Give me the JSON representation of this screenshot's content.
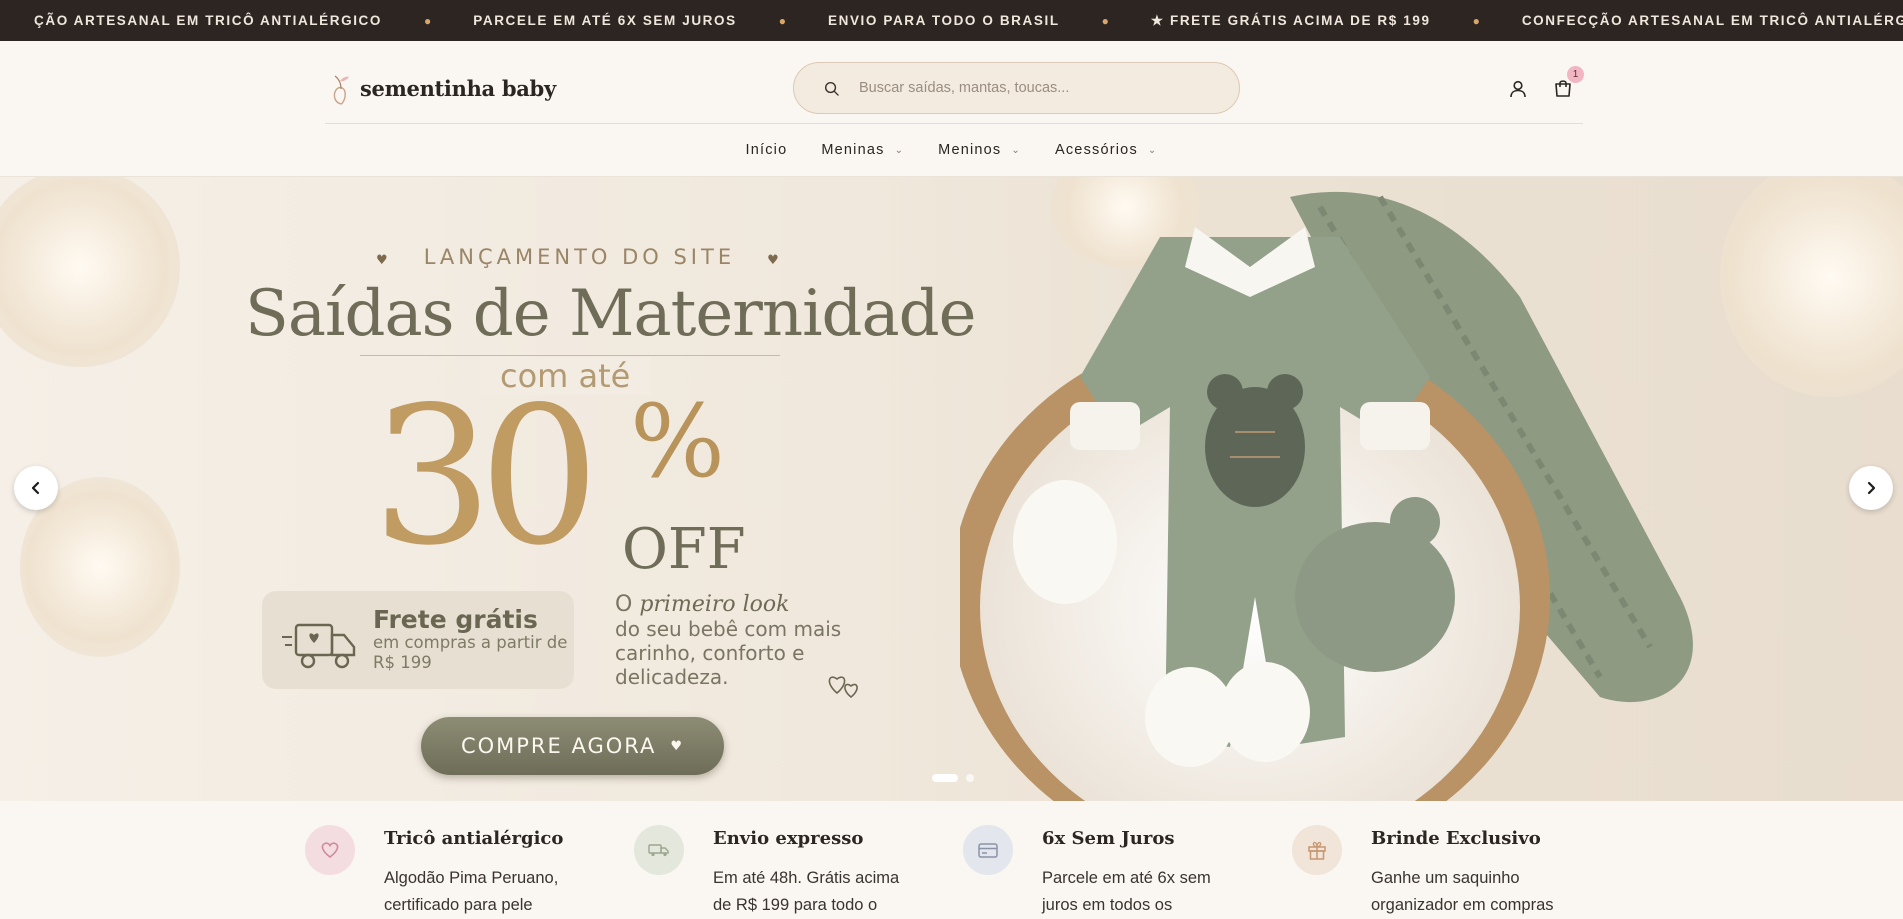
{
  "announcement": {
    "items": [
      "ÇÃO ARTESANAL EM TRICÔ ANTIALÉRGICO",
      "PARCELE EM ATÉ 6X SEM JUROS",
      "ENVIO PARA TODO O BRASIL",
      "★ FRETE GRÁTIS ACIMA DE R$ 199",
      "CONFECÇÃO ARTESANAL EM TRICÔ ANTIALÉRGICO"
    ],
    "separator": "●"
  },
  "header": {
    "brand": "sementinha baby",
    "search_placeholder": "Buscar saídas, mantas, toucas...",
    "cart_count": "1"
  },
  "nav": {
    "items": [
      {
        "label": "Início",
        "has_dropdown": false
      },
      {
        "label": "Meninas",
        "has_dropdown": true
      },
      {
        "label": "Meninos",
        "has_dropdown": true
      },
      {
        "label": "Acessórios",
        "has_dropdown": true
      }
    ]
  },
  "hero": {
    "eyebrow": "LANÇAMENTO DO SITE",
    "title": "Saídas de Maternidade",
    "com_ate": "com até",
    "discount_number": "30",
    "discount_percent": "%",
    "discount_off": "OFF",
    "frete_title": "Frete grátis",
    "frete_sub": "em compras a partir de R$ 199",
    "look_line1_prefix": "O",
    "look_line1_italic": "primeiro look",
    "look_rest": "do seu bebê com mais carinho, conforto e delicadeza.",
    "cta": "COMPRE AGORA",
    "slide_count": 2,
    "active_slide": 1
  },
  "features": [
    {
      "icon": "heart-icon",
      "title": "Tricô antialérgico",
      "desc": "Algodão Pima Peruano, certificado para pele",
      "color": "#f3dde0"
    },
    {
      "icon": "truck-icon",
      "title": "Envio expresso",
      "desc": "Em até 48h. Grátis acima de R$ 199 para todo o",
      "color": "#e3e7dc"
    },
    {
      "icon": "credit-card-icon",
      "title": "6x Sem Juros",
      "desc": "Parcele em até 6x sem juros em todos os",
      "color": "#e3e6ec"
    },
    {
      "icon": "gift-icon",
      "title": "Brinde Exclusivo",
      "desc": "Ganhe um saquinho organizador em compras",
      "color": "#f1e4d8"
    }
  ],
  "colors": {
    "topbar": "#2c2521",
    "background": "#faf6f1",
    "cta": "#7d7c66",
    "accent_gold": "#c09b62",
    "sage": "#8b9680"
  }
}
